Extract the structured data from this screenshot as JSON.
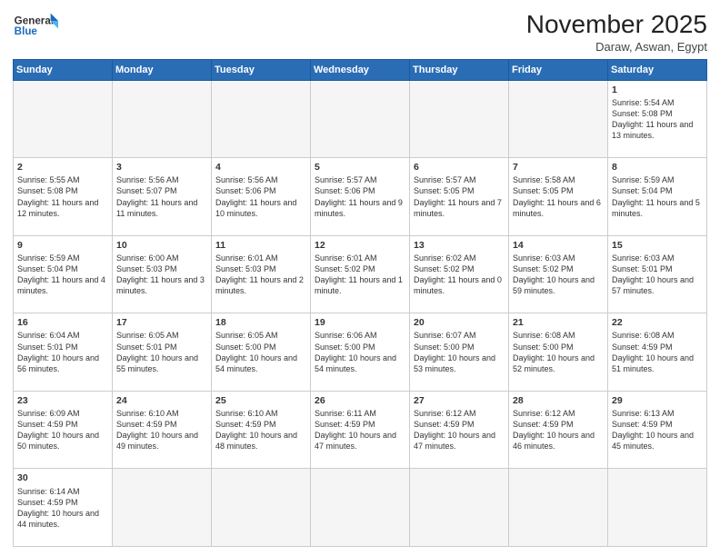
{
  "header": {
    "logo_general": "General",
    "logo_blue": "Blue",
    "month_title": "November 2025",
    "location": "Daraw, Aswan, Egypt"
  },
  "weekdays": [
    "Sunday",
    "Monday",
    "Tuesday",
    "Wednesday",
    "Thursday",
    "Friday",
    "Saturday"
  ],
  "weeks": [
    [
      {
        "day": "",
        "info": ""
      },
      {
        "day": "",
        "info": ""
      },
      {
        "day": "",
        "info": ""
      },
      {
        "day": "",
        "info": ""
      },
      {
        "day": "",
        "info": ""
      },
      {
        "day": "",
        "info": ""
      },
      {
        "day": "1",
        "info": "Sunrise: 5:54 AM\nSunset: 5:08 PM\nDaylight: 11 hours and 13 minutes."
      }
    ],
    [
      {
        "day": "2",
        "info": "Sunrise: 5:55 AM\nSunset: 5:08 PM\nDaylight: 11 hours and 12 minutes."
      },
      {
        "day": "3",
        "info": "Sunrise: 5:56 AM\nSunset: 5:07 PM\nDaylight: 11 hours and 11 minutes."
      },
      {
        "day": "4",
        "info": "Sunrise: 5:56 AM\nSunset: 5:06 PM\nDaylight: 11 hours and 10 minutes."
      },
      {
        "day": "5",
        "info": "Sunrise: 5:57 AM\nSunset: 5:06 PM\nDaylight: 11 hours and 9 minutes."
      },
      {
        "day": "6",
        "info": "Sunrise: 5:57 AM\nSunset: 5:05 PM\nDaylight: 11 hours and 7 minutes."
      },
      {
        "day": "7",
        "info": "Sunrise: 5:58 AM\nSunset: 5:05 PM\nDaylight: 11 hours and 6 minutes."
      },
      {
        "day": "8",
        "info": "Sunrise: 5:59 AM\nSunset: 5:04 PM\nDaylight: 11 hours and 5 minutes."
      }
    ],
    [
      {
        "day": "9",
        "info": "Sunrise: 5:59 AM\nSunset: 5:04 PM\nDaylight: 11 hours and 4 minutes."
      },
      {
        "day": "10",
        "info": "Sunrise: 6:00 AM\nSunset: 5:03 PM\nDaylight: 11 hours and 3 minutes."
      },
      {
        "day": "11",
        "info": "Sunrise: 6:01 AM\nSunset: 5:03 PM\nDaylight: 11 hours and 2 minutes."
      },
      {
        "day": "12",
        "info": "Sunrise: 6:01 AM\nSunset: 5:02 PM\nDaylight: 11 hours and 1 minute."
      },
      {
        "day": "13",
        "info": "Sunrise: 6:02 AM\nSunset: 5:02 PM\nDaylight: 11 hours and 0 minutes."
      },
      {
        "day": "14",
        "info": "Sunrise: 6:03 AM\nSunset: 5:02 PM\nDaylight: 10 hours and 59 minutes."
      },
      {
        "day": "15",
        "info": "Sunrise: 6:03 AM\nSunset: 5:01 PM\nDaylight: 10 hours and 57 minutes."
      }
    ],
    [
      {
        "day": "16",
        "info": "Sunrise: 6:04 AM\nSunset: 5:01 PM\nDaylight: 10 hours and 56 minutes."
      },
      {
        "day": "17",
        "info": "Sunrise: 6:05 AM\nSunset: 5:01 PM\nDaylight: 10 hours and 55 minutes."
      },
      {
        "day": "18",
        "info": "Sunrise: 6:05 AM\nSunset: 5:00 PM\nDaylight: 10 hours and 54 minutes."
      },
      {
        "day": "19",
        "info": "Sunrise: 6:06 AM\nSunset: 5:00 PM\nDaylight: 10 hours and 54 minutes."
      },
      {
        "day": "20",
        "info": "Sunrise: 6:07 AM\nSunset: 5:00 PM\nDaylight: 10 hours and 53 minutes."
      },
      {
        "day": "21",
        "info": "Sunrise: 6:08 AM\nSunset: 5:00 PM\nDaylight: 10 hours and 52 minutes."
      },
      {
        "day": "22",
        "info": "Sunrise: 6:08 AM\nSunset: 4:59 PM\nDaylight: 10 hours and 51 minutes."
      }
    ],
    [
      {
        "day": "23",
        "info": "Sunrise: 6:09 AM\nSunset: 4:59 PM\nDaylight: 10 hours and 50 minutes."
      },
      {
        "day": "24",
        "info": "Sunrise: 6:10 AM\nSunset: 4:59 PM\nDaylight: 10 hours and 49 minutes."
      },
      {
        "day": "25",
        "info": "Sunrise: 6:10 AM\nSunset: 4:59 PM\nDaylight: 10 hours and 48 minutes."
      },
      {
        "day": "26",
        "info": "Sunrise: 6:11 AM\nSunset: 4:59 PM\nDaylight: 10 hours and 47 minutes."
      },
      {
        "day": "27",
        "info": "Sunrise: 6:12 AM\nSunset: 4:59 PM\nDaylight: 10 hours and 47 minutes."
      },
      {
        "day": "28",
        "info": "Sunrise: 6:12 AM\nSunset: 4:59 PM\nDaylight: 10 hours and 46 minutes."
      },
      {
        "day": "29",
        "info": "Sunrise: 6:13 AM\nSunset: 4:59 PM\nDaylight: 10 hours and 45 minutes."
      }
    ],
    [
      {
        "day": "30",
        "info": "Sunrise: 6:14 AM\nSunset: 4:59 PM\nDaylight: 10 hours and 44 minutes."
      },
      {
        "day": "",
        "info": ""
      },
      {
        "day": "",
        "info": ""
      },
      {
        "day": "",
        "info": ""
      },
      {
        "day": "",
        "info": ""
      },
      {
        "day": "",
        "info": ""
      },
      {
        "day": "",
        "info": ""
      }
    ]
  ]
}
